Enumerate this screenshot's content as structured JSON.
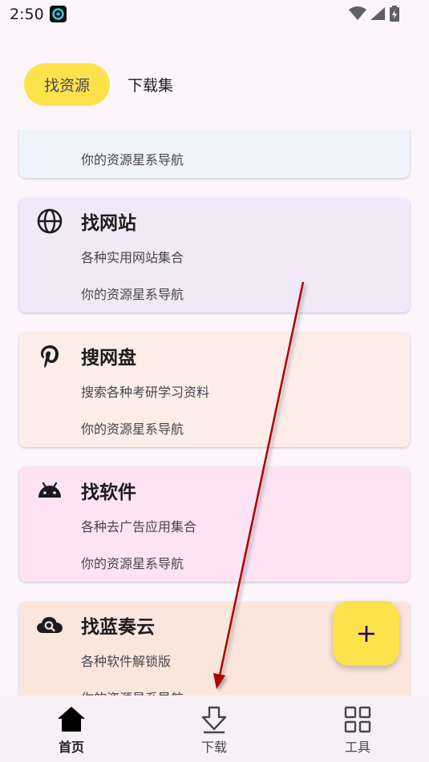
{
  "status_bar": {
    "time": "2:50"
  },
  "tabs": [
    {
      "label": "找资源",
      "active": true
    },
    {
      "label": "下载集",
      "active": false
    }
  ],
  "cards": [
    {
      "title": "",
      "desc": "",
      "footer": "你的资源星系导航",
      "bg": "#eef3fc"
    },
    {
      "title": "找网站",
      "desc": "各种实用网站集合",
      "footer": "你的资源星系导航",
      "icon": "globe-icon",
      "bg": "#f1e9f8"
    },
    {
      "title": "搜网盘",
      "desc": "搜索各种考研学习资料",
      "footer": "你的资源星系导航",
      "icon": "pinterest-icon",
      "bg": "#fcede9"
    },
    {
      "title": "找软件",
      "desc": "各种去广告应用集合",
      "footer": "你的资源星系导航",
      "icon": "android-icon",
      "bg": "#fde3f3"
    },
    {
      "title": "找蓝奏云",
      "desc": "各种软件解锁版",
      "footer": "你的资源星系导航",
      "icon": "cloud-search-icon",
      "bg": "#fbe6de"
    }
  ],
  "fab": {
    "icon": "plus-icon",
    "color": "#fde24c"
  },
  "bottom_nav": [
    {
      "label": "首页",
      "icon": "home-icon",
      "active": true
    },
    {
      "label": "下载",
      "icon": "download-icon",
      "active": false
    },
    {
      "label": "工具",
      "icon": "grid-icon",
      "active": false
    }
  ],
  "colors": {
    "accent": "#fde24c",
    "arrow": "#b00000"
  }
}
